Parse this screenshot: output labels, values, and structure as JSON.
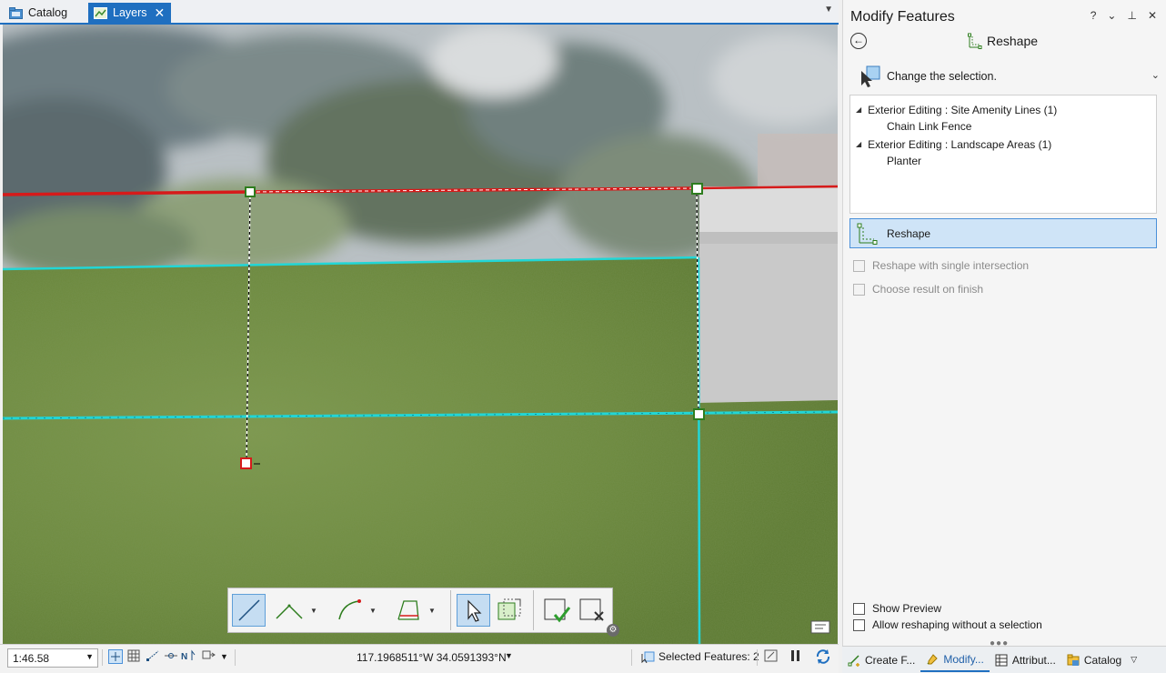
{
  "tabs": [
    {
      "label": "Catalog",
      "active": false,
      "icon": "catalog-icon"
    },
    {
      "label": "Layers",
      "active": true,
      "icon": "map-icon"
    }
  ],
  "pane": {
    "title": "Modify Features",
    "controls": {
      "help": "?",
      "menu": "⌄",
      "pin": "⊥",
      "close": "✕"
    },
    "tool_name": "Reshape",
    "change_selection_label": "Change the selection.",
    "selection_tree": [
      {
        "layer": "Exterior Editing : Site Amenity Lines (1)",
        "features": [
          "Chain Link Fence"
        ]
      },
      {
        "layer": "Exterior Editing : Landscape Areas (1)",
        "features": [
          "Planter"
        ]
      }
    ],
    "reshape_button_label": "Reshape",
    "options": {
      "single_intersection": {
        "label": "Reshape with single intersection",
        "checked": false,
        "enabled": false
      },
      "choose_result": {
        "label": "Choose result on finish",
        "checked": false,
        "enabled": false
      },
      "show_preview": {
        "label": "Show Preview",
        "checked": false,
        "enabled": true
      },
      "allow_without_selection": {
        "label": "Allow reshaping without a selection",
        "checked": false,
        "enabled": true
      }
    }
  },
  "bottom_tabs": [
    {
      "label": "Create F...",
      "icon": "create-features-icon",
      "active": false
    },
    {
      "label": "Modify...",
      "icon": "modify-features-icon",
      "active": true
    },
    {
      "label": "Attribut...",
      "icon": "attributes-icon",
      "active": false
    },
    {
      "label": "Catalog",
      "icon": "catalog-icon",
      "active": false
    }
  ],
  "status": {
    "scale": "1:46.58",
    "coordinates": "117.1968511°W 34.0591393°N",
    "selected_features": "Selected Features: 2"
  },
  "toolbar": {
    "tools": [
      "line",
      "right-angle-line",
      "arc",
      "trace",
      "select",
      "select-extent",
      "finish",
      "discard"
    ],
    "active": [
      "line",
      "select"
    ]
  },
  "colors": {
    "accent": "#1f6fc0",
    "fence_line": "#d61a1a",
    "landscape_line": "#22d6d6",
    "vertex_green": "#2e7d1e",
    "vertex_red": "#d61a1a"
  }
}
